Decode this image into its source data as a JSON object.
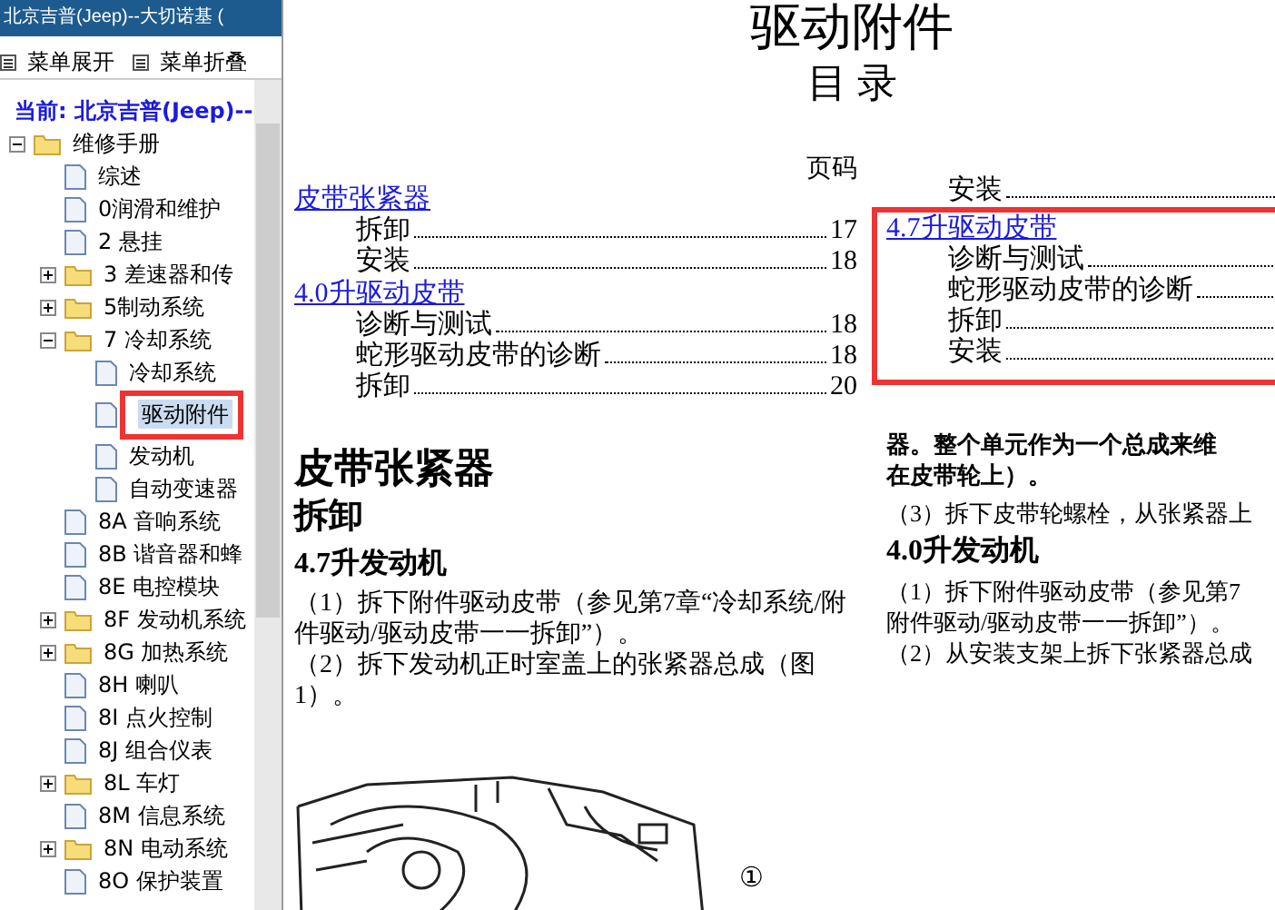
{
  "window": {
    "title": "北京吉普(Jeep)--大切诺基 ("
  },
  "menu": [
    {
      "label": "菜单展开"
    },
    {
      "label": "菜单折叠"
    }
  ],
  "tree": {
    "label": "当前: 北京吉普(Jeep)--",
    "children": [
      {
        "label": "维修手册",
        "kind": "folder",
        "expanded": true,
        "selected": false,
        "children": [
          {
            "label": "综述",
            "kind": "page",
            "selected": false
          },
          {
            "label": "0润滑和维护",
            "kind": "page",
            "selected": false
          },
          {
            "label": "2 悬挂",
            "kind": "page",
            "selected": false
          },
          {
            "label": "3 差速器和传",
            "kind": "folder",
            "expanded": false,
            "selected": false
          },
          {
            "label": "5制动系统",
            "kind": "folder",
            "expanded": false,
            "selected": false
          },
          {
            "label": "7 冷却系统",
            "kind": "folder",
            "expanded": true,
            "selected": false,
            "children": [
              {
                "label": "冷却系统",
                "kind": "page",
                "selected": false
              },
              {
                "label": "驱动附件",
                "kind": "page",
                "selected": true,
                "annotated": true
              },
              {
                "label": "发动机",
                "kind": "page",
                "selected": false
              },
              {
                "label": "自动变速器",
                "kind": "page",
                "selected": false
              }
            ]
          },
          {
            "label": "8A 音响系统",
            "kind": "page",
            "selected": false
          },
          {
            "label": "8B 谐音器和蜂",
            "kind": "page",
            "selected": false
          },
          {
            "label": "8E 电控模块",
            "kind": "page",
            "selected": false
          },
          {
            "label": "8F 发动机系统",
            "kind": "folder",
            "expanded": false,
            "selected": false
          },
          {
            "label": "8G 加热系统",
            "kind": "folder",
            "expanded": false,
            "selected": false
          },
          {
            "label": "8H 喇叭",
            "kind": "page",
            "selected": false
          },
          {
            "label": "8I 点火控制",
            "kind": "page",
            "selected": false
          },
          {
            "label": "8J 组合仪表",
            "kind": "page",
            "selected": false
          },
          {
            "label": "8L 车灯",
            "kind": "folder",
            "expanded": false,
            "selected": false
          },
          {
            "label": "8M 信息系统",
            "kind": "page",
            "selected": false
          },
          {
            "label": "8N 电动系统",
            "kind": "folder",
            "expanded": false,
            "selected": false
          },
          {
            "label": "8O 保护装置",
            "kind": "page",
            "selected": false
          }
        ]
      }
    ]
  },
  "document": {
    "title": "驱动附件",
    "subtitle": "目 录",
    "left": {
      "page_header": "页码",
      "toc": [
        {
          "heading": "皮带张紧器",
          "items": [
            {
              "label": "拆卸",
              "page": "17"
            },
            {
              "label": "安装",
              "page": "18"
            }
          ]
        },
        {
          "heading": "4.0升驱动皮带",
          "items": [
            {
              "label": "诊断与测试",
              "page": "18"
            },
            {
              "label": "蛇形驱动皮带的诊断",
              "page": "18"
            },
            {
              "label": "拆卸",
              "page": "20"
            }
          ]
        }
      ],
      "body": [
        {
          "kind": "h1",
          "text": "皮带张紧器"
        },
        {
          "kind": "h2",
          "text": "拆卸"
        },
        {
          "kind": "h3",
          "text": "4.7升发动机"
        },
        {
          "kind": "para",
          "lines": [
            "（1）拆下附件驱动皮带（参见第7章“冷却系统/附",
            "件驱动/驱动皮带一一拆卸”）。"
          ]
        },
        {
          "kind": "para",
          "lines": [
            "（2）拆下发动机正时室盖上的张紧器总成（图",
            "1）。"
          ]
        }
      ],
      "figure": {
        "callout": "①"
      }
    },
    "right": {
      "toc": [
        {
          "items": [
            {
              "label": "安装"
            }
          ]
        },
        {
          "heading": "4.7升驱动皮带",
          "annotated": true,
          "items": [
            {
              "label": "诊断与测试"
            },
            {
              "label": "蛇形驱动皮带的诊断"
            },
            {
              "label": "拆卸"
            },
            {
              "label": "安装"
            }
          ]
        }
      ],
      "body": [
        {
          "kind": "bold",
          "lines": [
            "器。整个单元作为一个总成来维",
            "在皮带轮上）。"
          ]
        },
        {
          "kind": "para",
          "lines": [
            "（3）拆下皮带轮螺栓，从张紧器上"
          ]
        },
        {
          "kind": "h3",
          "text": "4.0升发动机"
        },
        {
          "kind": "para",
          "lines": [
            "（1）拆下附件驱动皮带（参见第7",
            "附件驱动/驱动皮带一一拆卸”）。",
            "（2）从安装支架上拆下张紧器总成"
          ]
        }
      ]
    }
  }
}
